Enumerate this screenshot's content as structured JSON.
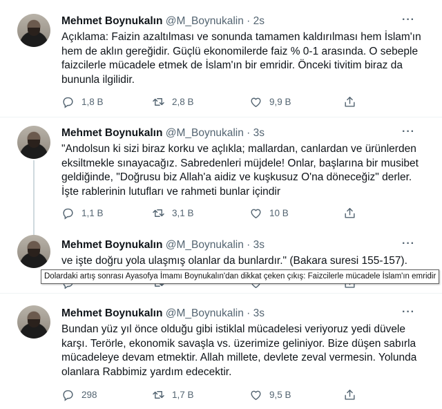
{
  "tweets": [
    {
      "name": "Mehmet Boynukalın",
      "handle": "@M_Boynukalin",
      "time": "· 2s",
      "lines": [
        "Açıklama: Faizin azaltılması ve sonunda tamamen kaldırılması hem İslam'ın",
        "hem de aklın gereğidir. Güçlü ekonomilerde faiz % 0-1 arasında. O sebeple",
        "faizcilerle mücadele etmek de İslam'ın bir emridir. Önceki tivitim biraz da",
        "bununla ilgilidir."
      ],
      "replies": "1,8 B",
      "retweets": "2,8 B",
      "likes": "9,9 B"
    },
    {
      "name": "Mehmet Boynukalın",
      "handle": "@M_Boynukalin",
      "time": "· 3s",
      "lines": [
        "\"Andolsun ki sizi biraz korku ve açlıkla; mallardan, canlardan ve ürünlerden",
        "eksiltmekle sınayacağız. Sabredenleri müjdele! Onlar, başlarına bir musibet",
        "geldiğinde, \"Doğrusu biz Allah'a aidiz ve kuşkusuz O'na döneceğiz\" derler.",
        "İşte rablerinin lutufları ve rahmeti bunlar içindir"
      ],
      "replies": "1,1 B",
      "retweets": "3,1 B",
      "likes": "10 B"
    },
    {
      "name": "Mehmet Boynukalın",
      "handle": "@M_Boynukalin",
      "time": "· 3s",
      "lines": [
        "ve işte doğru yola ulaşmış olanlar da bunlardır.\" (Bakara suresi 155-157)."
      ]
    },
    {
      "name": "Mehmet Boynukalın",
      "handle": "@M_Boynukalin",
      "time": "· 3s",
      "lines": [
        "Bundan yüz yıl önce olduğu gibi istiklal mücadelesi veriyoruz yedi düvele",
        "karşı. Terörle, ekonomik savaşla vs. üzerimize geliniyor. Bize düşen sabırla",
        "mücadeleye devam etmektir. Allah millete, devlete zeval vermesin. Yolunda",
        "olanlara Rabbimiz yardım edecektir."
      ],
      "replies": "298",
      "retweets": "1,7 B",
      "likes": "9,5 B"
    }
  ],
  "more_label": "···",
  "tooltip": "Dolardaki artış sonrası Ayasofya İmamı Boynukalın'dan dikkat çeken çıkış: Faizcilerle mücadele İslam'ın emridir",
  "icons": {
    "reply": "reply-icon",
    "retweet": "retweet-icon",
    "like": "like-icon",
    "share": "share-icon"
  },
  "colors": {
    "text": "#0f1419",
    "muted": "#536471",
    "thread_line": "#cfd9de"
  }
}
